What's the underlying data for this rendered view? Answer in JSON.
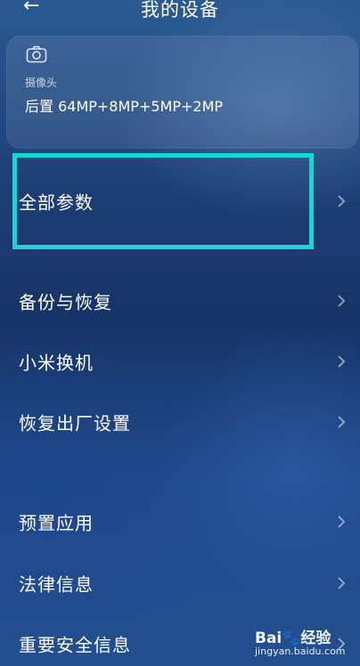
{
  "header": {
    "back_icon": "arrow-left-icon",
    "title": "我的设备"
  },
  "camera_card": {
    "icon": "camera-icon",
    "label": "摄像头",
    "value": "后置 64MP+8MP+5MP+2MP"
  },
  "menu": {
    "chevron_icon": "chevron-right-icon",
    "items": [
      {
        "label": "全部参数",
        "highlighted": true
      },
      {
        "label": "备份与恢复"
      },
      {
        "label": "小米换机"
      },
      {
        "label": "恢复出厂设置"
      },
      {
        "label": "预置应用"
      },
      {
        "label": "法律信息"
      },
      {
        "label": "重要安全信息"
      }
    ]
  },
  "colors": {
    "highlight_border": "#19d6d6",
    "text": "#ffffff"
  },
  "watermark": {
    "main": "Bai🐾经验",
    "sub": "jingyan.baidu.com"
  }
}
